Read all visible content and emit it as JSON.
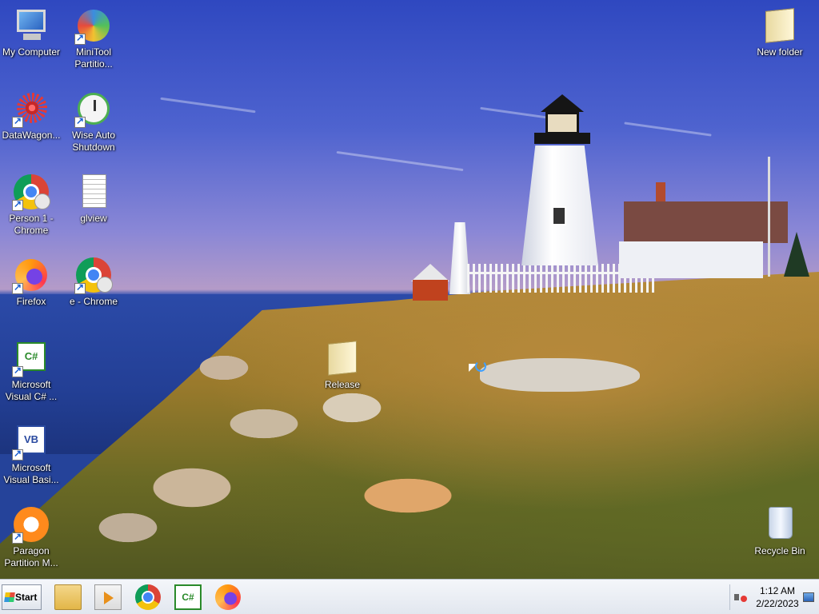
{
  "desktop": {
    "icons": [
      {
        "label": "My Computer"
      },
      {
        "label": "MiniTool Partitio..."
      },
      {
        "label": "DataWagon..."
      },
      {
        "label": "Wise Auto Shutdown"
      },
      {
        "label": "Person 1 - Chrome"
      },
      {
        "label": "glview"
      },
      {
        "label": "Firefox"
      },
      {
        "label": "e - Chrome"
      },
      {
        "label": "Microsoft Visual C# ..."
      },
      {
        "label": "Microsoft Visual Basi..."
      },
      {
        "label": "Paragon Partition M..."
      },
      {
        "label": "Release"
      },
      {
        "label": "New folder"
      },
      {
        "label": "Recycle Bin"
      }
    ],
    "csharp_glyph": "C#",
    "vb_glyph": "VB"
  },
  "taskbar": {
    "start_label": "Start",
    "pinned": [
      {
        "icon": "file-explorer-icon"
      },
      {
        "icon": "media-player-icon"
      },
      {
        "icon": "chrome-icon"
      },
      {
        "icon": "visual-csharp-icon",
        "glyph": "C#"
      },
      {
        "icon": "firefox-icon"
      }
    ],
    "clock": {
      "time": "1:12 AM",
      "date": "2/22/2023"
    }
  }
}
